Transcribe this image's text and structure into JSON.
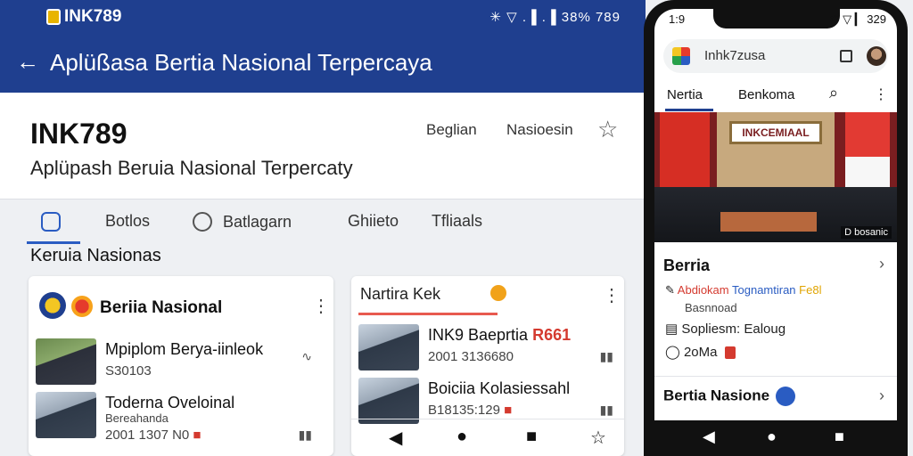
{
  "status": {
    "brand": "INK789",
    "system_icons": "✳ ▽ .▐ .▐ 38% 789"
  },
  "appbar": {
    "back_icon": "←",
    "title": "Aplüßasa Bertia Nasional Terpercaya"
  },
  "hero": {
    "name": "INK789",
    "tagline": "Aplüpash Beruia Nasional Terpercaty",
    "nav": [
      "Beglian",
      "Nasioesin"
    ],
    "star_icon": "☆"
  },
  "tabs": [
    {
      "label": "Botlos"
    },
    {
      "label": "Batlagarn"
    },
    {
      "label": "Ghiieto"
    },
    {
      "label": "Tfliaals"
    }
  ],
  "section": {
    "title": "Keruia Nasionas"
  },
  "card1": {
    "title": "Beriia Nasional",
    "kebab": "⋮",
    "items": [
      {
        "title": "Mpiplom Berya-iinleok",
        "meta": "S30103",
        "action": "∿"
      },
      {
        "title": "Toderna Oveloinal",
        "meta": "Bereahanda",
        "meta2": "2001 1307 N0",
        "tag": "■",
        "action": "▮▮"
      }
    ]
  },
  "card2": {
    "title": "Nartira Kek",
    "kebab": "⋮",
    "items": [
      {
        "title": "INK9 Baeprtia",
        "tag": "R661",
        "meta": "2001 3136680",
        "action": "▮▮"
      },
      {
        "title": "Boiciia Kolasiessahl",
        "meta": "B18135:129",
        "tag": "■",
        "action": "▮▮"
      }
    ],
    "nav": [
      "◀",
      "●",
      "■",
      "☆"
    ]
  },
  "phone": {
    "time": "1:9",
    "icons": "✱ ▽ ▎ 329",
    "search_text": "Inhk7zusa",
    "tabs": [
      "Nertia",
      "Benkoma"
    ],
    "search_icon": "⌕",
    "kebab": "⋮",
    "photo_sign": "INKCEMIAAL",
    "photo_caption": "D bosanic",
    "card": {
      "title": "Berria",
      "chevron": "›",
      "line1_a": "Abdiokam",
      "line1_b": "Tognamtiran",
      "line1_c": "Fe8l",
      "line2": "Basnnoad",
      "line3": "Sopliesm: Ealoug",
      "line4": "2oMa"
    },
    "bottom_title": "Bertia Nasione",
    "bottom_chevron": "›",
    "nav": [
      "◀",
      "●",
      "■"
    ]
  }
}
